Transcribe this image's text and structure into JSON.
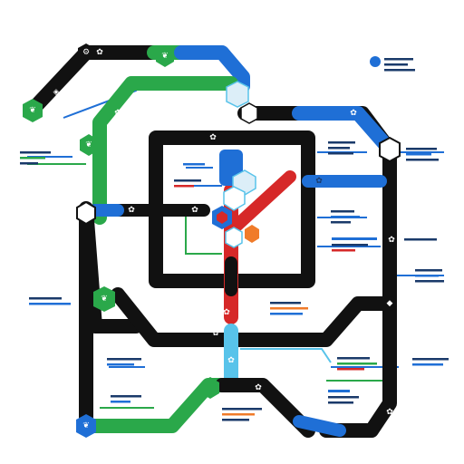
{
  "colors": {
    "black": "#111111",
    "green": "#2aa84a",
    "blue": "#1f6fd6",
    "red": "#d62828",
    "cyan": "#58c3ea",
    "orange": "#f07b2a",
    "ice": "#dceef8",
    "background": "#ffffff"
  },
  "icons": {
    "station": "hexagon-station-icon",
    "leaf": "leaf-icon",
    "gear": "gear-icon",
    "cube": "ice-cube-icon",
    "droplet": "droplet-icon",
    "label": "label-pin-icon"
  },
  "legend": {
    "label_blocks": 18
  }
}
